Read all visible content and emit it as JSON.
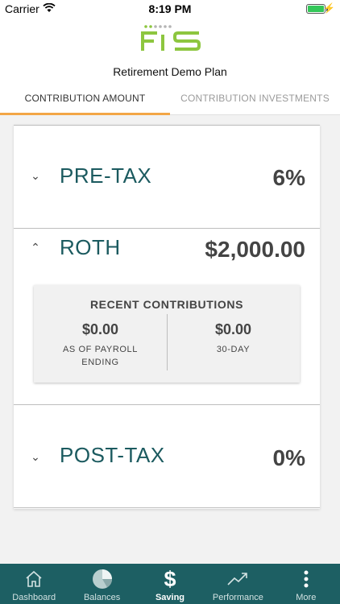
{
  "status_bar": {
    "carrier": "Carrier",
    "time": "8:19 PM"
  },
  "header": {
    "plan_title": "Retirement Demo Plan",
    "logo_text": "FIS"
  },
  "tabs": [
    {
      "label": "CONTRIBUTION AMOUNT",
      "active": true
    },
    {
      "label": "CONTRIBUTION INVESTMENTS",
      "active": false
    }
  ],
  "sections": {
    "pretax": {
      "label": "PRE-TAX",
      "value": "6%",
      "chevron": "⌄"
    },
    "roth": {
      "label": "ROTH",
      "value": "$2,000.00",
      "chevron": "⌃"
    },
    "posttax": {
      "label": "POST-TAX",
      "value": "0%",
      "chevron": "⌄"
    }
  },
  "recent_contributions": {
    "title": "RECENT CONTRIBUTIONS",
    "left_amount": "$0.00",
    "left_label_line1": "AS OF PAYROLL",
    "left_label_line2": "ENDING",
    "right_amount": "$0.00",
    "right_label": "30-DAY"
  },
  "bottom_nav": [
    {
      "label": "Dashboard",
      "icon": "home-icon"
    },
    {
      "label": "Balances",
      "icon": "pie-chart-icon"
    },
    {
      "label": "Saving",
      "icon": "dollar-icon"
    },
    {
      "label": "Performance",
      "icon": "trend-icon"
    },
    {
      "label": "More",
      "icon": "more-vertical-icon"
    }
  ],
  "colors": {
    "accent": "#f3a646",
    "brand_teal": "#1d5f63",
    "logo_green": "#8dc63f"
  }
}
